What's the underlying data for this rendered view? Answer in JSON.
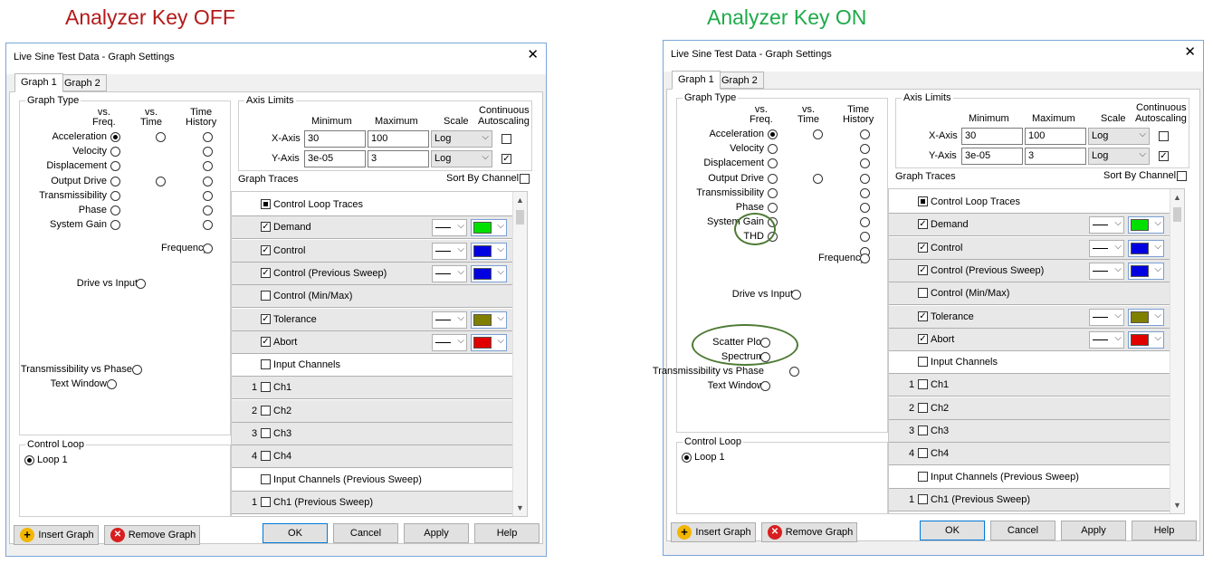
{
  "headings": {
    "off": "Analyzer Key OFF",
    "on": "Analyzer Key ON",
    "off_color": "#b41a1a",
    "on_color": "#1faa4a"
  },
  "dialog": {
    "title": "Live Sine Test Data - Graph Settings",
    "close_icon": "close-icon",
    "tabs": [
      "Graph 1",
      "Graph 2"
    ],
    "graph_type": {
      "title": "Graph Type",
      "col_freq": "vs.\nFreq.",
      "col_time": "vs.\nTime",
      "col_history": "Time\nHistory",
      "rows": [
        "Acceleration",
        "Velocity",
        "Displacement",
        "Output Drive",
        "Transmissibility",
        "Phase",
        "System Gain"
      ],
      "thd": "THD",
      "frequency": "Frequency",
      "drive_vs_input": "Drive vs Input",
      "scatter_plot": "Scatter Plot",
      "spectrum": "Spectrum",
      "transmissibility_vs_phase": "Transmissibility vs Phase",
      "text_window": "Text Window"
    },
    "control_loop": {
      "title": "Control Loop",
      "loop": "Loop 1"
    },
    "axis_limits": {
      "title": "Axis Limits",
      "minimum": "Minimum",
      "maximum": "Maximum",
      "scale": "Scale",
      "continuous": "Continuous",
      "autoscaling": "Autoscaling",
      "x_label": "X-Axis",
      "x_min": "30",
      "x_max": "100",
      "x_scale": "Log",
      "y_label": "Y-Axis",
      "y_min": "3e-05",
      "y_max": "3",
      "y_scale": "Log"
    },
    "graph_traces": {
      "title": "Graph Traces",
      "sort_by_channel": "Sort By Channel",
      "rows": [
        {
          "label": "Control Loop Traces",
          "num": "",
          "state": "square",
          "shade": "white"
        },
        {
          "label": "Demand",
          "num": "",
          "state": "checked",
          "shade": "grey",
          "color": "#00e000"
        },
        {
          "label": "Control",
          "num": "",
          "state": "checked",
          "shade": "grey",
          "color": "#0000e0"
        },
        {
          "label": "Control (Previous Sweep)",
          "num": "",
          "state": "checked",
          "shade": "grey",
          "color": "#0000e0"
        },
        {
          "label": "Control (Min/Max)",
          "num": "",
          "state": "unchecked",
          "shade": "grey"
        },
        {
          "label": "Tolerance",
          "num": "",
          "state": "checked",
          "shade": "grey",
          "color": "#808000"
        },
        {
          "label": "Abort",
          "num": "",
          "state": "checked",
          "shade": "grey",
          "color": "#e00000"
        },
        {
          "label": "Input Channels",
          "num": "",
          "state": "unchecked",
          "shade": "white"
        },
        {
          "label": "Ch1",
          "num": "1",
          "state": "unchecked",
          "shade": "grey"
        },
        {
          "label": "Ch2",
          "num": "2",
          "state": "unchecked",
          "shade": "grey"
        },
        {
          "label": "Ch3",
          "num": "3",
          "state": "unchecked",
          "shade": "grey"
        },
        {
          "label": "Ch4",
          "num": "4",
          "state": "unchecked",
          "shade": "grey"
        },
        {
          "label": "Input Channels (Previous Sweep)",
          "num": "",
          "state": "unchecked",
          "shade": "white"
        },
        {
          "label": "Ch1 (Previous Sweep)",
          "num": "1",
          "state": "unchecked",
          "shade": "grey"
        }
      ]
    },
    "buttons": {
      "insert_graph": "Insert Graph",
      "remove_graph": "Remove Graph",
      "ok": "OK",
      "cancel": "Cancel",
      "apply": "Apply",
      "help": "Help",
      "insert_icon": "plus-circle-icon",
      "remove_icon": "x-circle-icon"
    }
  },
  "annotation_color": "#4e7a34"
}
